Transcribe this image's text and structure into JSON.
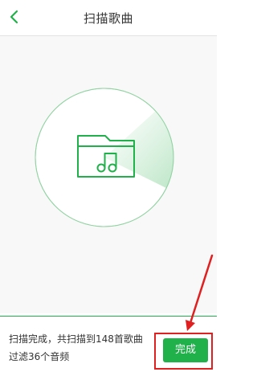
{
  "header": {
    "title": "扫描歌曲",
    "back_icon": "chevron-left-icon"
  },
  "main": {
    "graphic_icon": "music-folder-icon",
    "scan_progress": 1.0
  },
  "footer": {
    "status_line1": "扫描完成，共扫描到148首歌曲",
    "status_line2": "过滤36个音频",
    "done_label": "完成"
  },
  "colors": {
    "accent": "#21b14b",
    "annotation": "#e02020"
  }
}
